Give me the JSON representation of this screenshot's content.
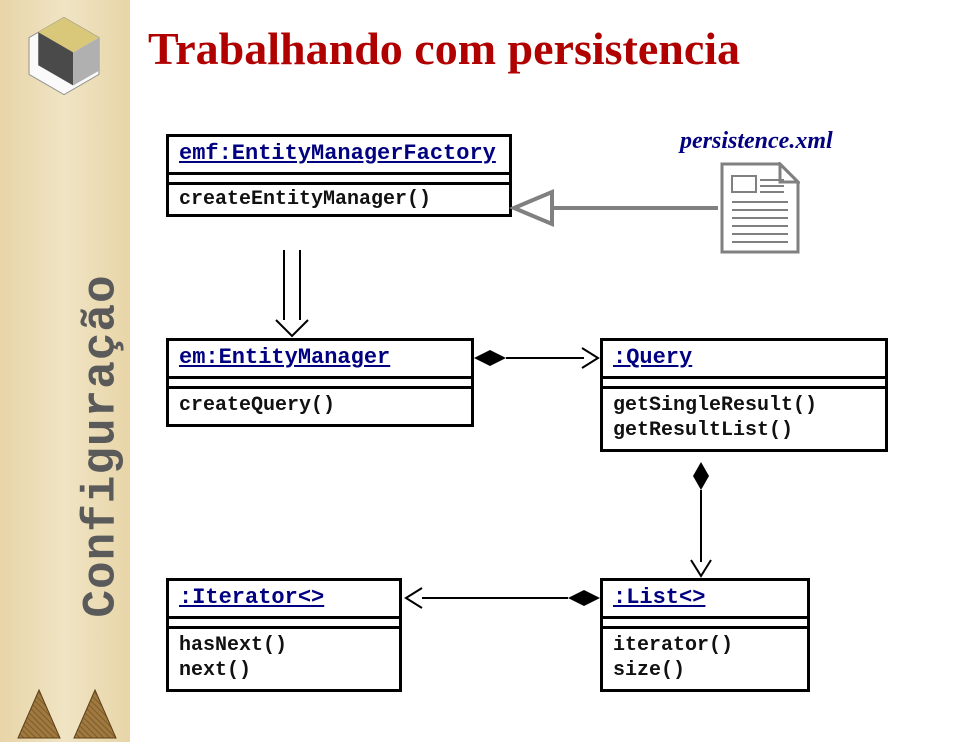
{
  "title": "Trabalhando com persistencia",
  "sidebar_label": "Configuração",
  "note": "persistence.xml",
  "boxes": {
    "emf": {
      "name": "emf:EntityManagerFactory",
      "methods": [
        "createEntityManager()"
      ]
    },
    "em": {
      "name": "em:EntityManager",
      "methods": [
        "createQuery()"
      ]
    },
    "query": {
      "name": ":Query",
      "methods": [
        "getSingleResult()",
        "getResultList()"
      ]
    },
    "iterator": {
      "name": ":Iterator<>",
      "methods": [
        "hasNext()",
        "next()"
      ]
    },
    "list": {
      "name": ":List<>",
      "methods": [
        "iterator()",
        "size()"
      ]
    }
  }
}
